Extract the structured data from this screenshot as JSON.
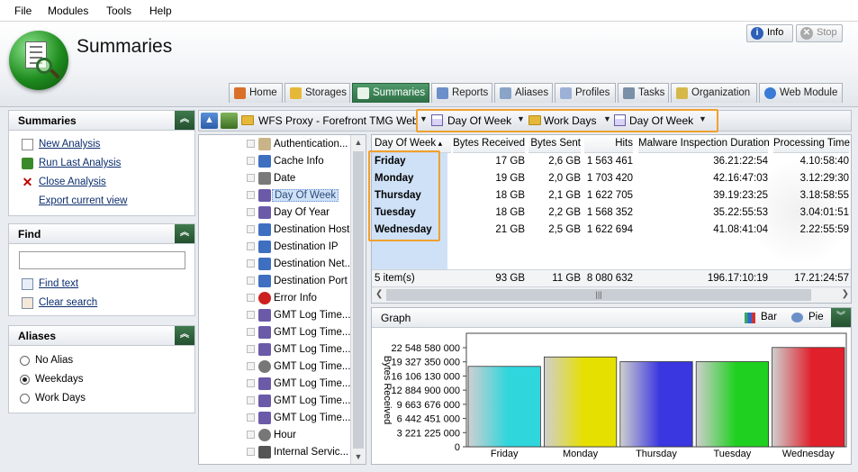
{
  "menu": [
    "File",
    "Modules",
    "Tools",
    "Help"
  ],
  "header": {
    "title": "Summaries",
    "info_label": "Info",
    "stop_label": "Stop"
  },
  "tabs": [
    "Home",
    "Storages",
    "Summaries",
    "Reports",
    "Aliases",
    "Profiles",
    "Tasks",
    "Organization",
    "Web Module"
  ],
  "summaries_panel": {
    "title": "Summaries",
    "links": [
      "New Analysis",
      "Run Last Analysis",
      "Close Analysis",
      "Export current view"
    ]
  },
  "find_panel": {
    "title": "Find",
    "input_value": "",
    "links": [
      "Find text",
      "Clear search"
    ]
  },
  "aliases_panel": {
    "title": "Aliases",
    "options": [
      "No Alias",
      "Weekdays",
      "Work Days"
    ],
    "selected": "Weekdays"
  },
  "breadcrumb": [
    "WFS Proxy - Forefront TMG Web",
    "Day Of Week",
    "Work Days",
    "Day Of Week"
  ],
  "tree_items": [
    "Authentication...",
    "Cache Info",
    "Date",
    "Day Of Week",
    "Day Of Year",
    "Destination Host",
    "Destination IP",
    "Destination Net...",
    "Destination Port",
    "Error Info",
    "GMT Log Time...",
    "GMT Log Time...",
    "GMT Log Time...",
    "GMT Log Time...",
    "GMT Log Time...",
    "GMT Log Time...",
    "GMT Log Time...",
    "Hour",
    "Internal Servic..."
  ],
  "tree_selected": "Day Of Week",
  "grid": {
    "columns": [
      "Day Of Week",
      "Bytes Received",
      "Bytes Sent",
      "Hits",
      "Malware Inspection Duration",
      "Processing Time"
    ],
    "rows": [
      [
        "Friday",
        "17 GB",
        "2,6 GB",
        "1 563 461",
        "36.21:22:54",
        "4.10:58:40"
      ],
      [
        "Monday",
        "19 GB",
        "2,0 GB",
        "1 703 420",
        "42.16:47:03",
        "3.12:29:30"
      ],
      [
        "Thursday",
        "18 GB",
        "2,1 GB",
        "1 622 705",
        "39.19:23:25",
        "3.18:58:55"
      ],
      [
        "Tuesday",
        "18 GB",
        "2,2 GB",
        "1 568 352",
        "35.22:55:53",
        "3.04:01:51"
      ],
      [
        "Wednesday",
        "21 GB",
        "2,5 GB",
        "1 622 694",
        "41.08:41:04",
        "2.22:55:59"
      ]
    ],
    "footer": [
      "5 item(s)",
      "93 GB",
      "11 GB",
      "8 080 632",
      "196.17:10:19",
      "17.21:24:57"
    ]
  },
  "graph": {
    "title": "Graph",
    "bar_label": "Bar",
    "pie_label": "Pie"
  },
  "chart_data": {
    "type": "bar",
    "ylabel": "Bytes Received",
    "y_ticks": [
      "22 548 580 000",
      "19 327 350 000",
      "16 106 130 000",
      "12 884 900 000",
      "9 663 676 000",
      "6 442 451 000",
      "3 221 225 000",
      "0"
    ],
    "ylim": [
      0,
      25769803776
    ],
    "categories": [
      "Friday",
      "Monday",
      "Thursday",
      "Tuesday",
      "Wednesday"
    ],
    "values": [
      18253611008,
      20401094656,
      19327352832,
      19327352832,
      22548578304
    ],
    "colors": [
      "#2fd6dc",
      "#e6e000",
      "#3a36e0",
      "#20d020",
      "#e0202a"
    ]
  }
}
